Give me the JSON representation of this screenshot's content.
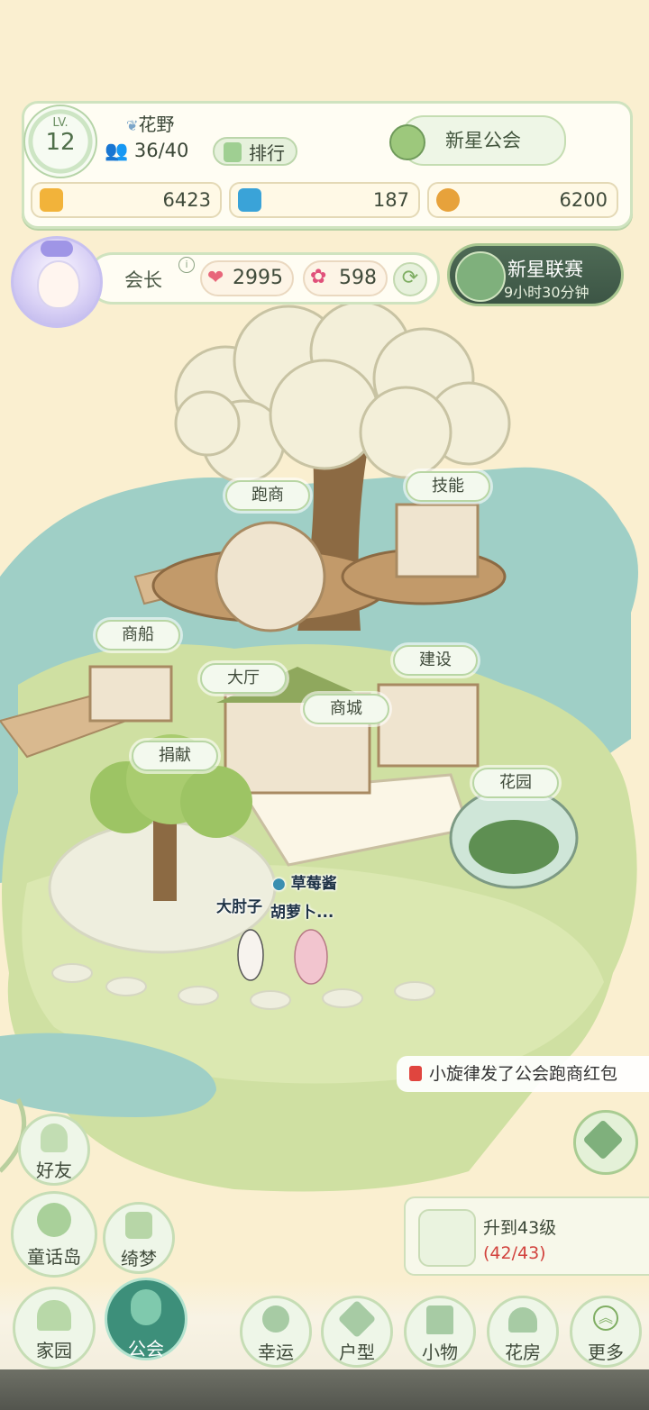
{
  "guild": {
    "level_tag": "LV.",
    "level": "12",
    "name": "花野",
    "members": "36/40",
    "rank_label": "排行",
    "badge_title": "新星公会"
  },
  "resources": [
    {
      "icon": "coin-icon",
      "value": "6423",
      "color": "#f2b33a"
    },
    {
      "icon": "diamond-icon",
      "value": "187",
      "color": "#3aa3d8"
    },
    {
      "icon": "medal-icon",
      "value": "6200",
      "color": "#e7a23b"
    }
  ],
  "leader": {
    "role": "会长",
    "info": "i",
    "hearts": "2995",
    "flowers": "598"
  },
  "event": {
    "title": "新星联赛",
    "timer": "9小时30分钟"
  },
  "buildings": {
    "trade": "跑商",
    "skill": "技能",
    "ship": "商船",
    "hall": "大厅",
    "build": "建设",
    "shop": "商城",
    "donate": "捐献",
    "garden": "花园"
  },
  "chat": {
    "name1": "草莓酱",
    "name2": "大肘子",
    "name3": "胡萝卜..."
  },
  "notice": "小旋律发了公会跑商红包",
  "quest": {
    "title": "升到43级",
    "progress": "(42/43)"
  },
  "side_menu": {
    "friends": "好友",
    "island": "童话岛",
    "dream": "绮梦"
  },
  "bottom_nav": {
    "home": "家园",
    "guild": "公会",
    "luck": "幸运",
    "layout": "户型",
    "items": "小物",
    "greenhouse": "花房",
    "more": "更多"
  }
}
